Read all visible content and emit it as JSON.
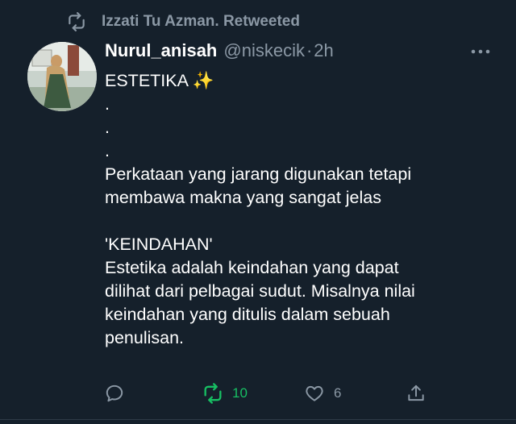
{
  "colors": {
    "background": "#15202b",
    "text_primary": "#ffffff",
    "text_secondary": "#8b98a5",
    "retweet_active": "#17bf63",
    "divider": "#2f3b47"
  },
  "retweet_context": {
    "icon": "retweet-icon",
    "text": "Izzati Tu Azman. Retweeted"
  },
  "author": {
    "display_name": "Nurul_anisah",
    "handle": "@niskecik",
    "separator": "·",
    "time": "2h",
    "avatar": "avatar-photo"
  },
  "more_icon": "more-options-icon",
  "tweet": {
    "lines": [
      "ESTETIKA ✨",
      ".",
      ".",
      ".",
      "Perkataan yang jarang digunakan tetapi",
      "membawa makna yang sangat jelas",
      "",
      "'KEINDAHAN'",
      "Estetika adalah keindahan yang dapat",
      "dilihat dari pelbagai sudut. Misalnya nilai",
      "keindahan yang ditulis dalam sebuah",
      "penulisan."
    ]
  },
  "actions": {
    "reply": {
      "icon": "reply-icon",
      "count": ""
    },
    "retweet": {
      "icon": "retweet-icon",
      "count": "10",
      "active": true
    },
    "like": {
      "icon": "heart-icon",
      "count": "6"
    },
    "share": {
      "icon": "share-icon",
      "count": ""
    }
  }
}
